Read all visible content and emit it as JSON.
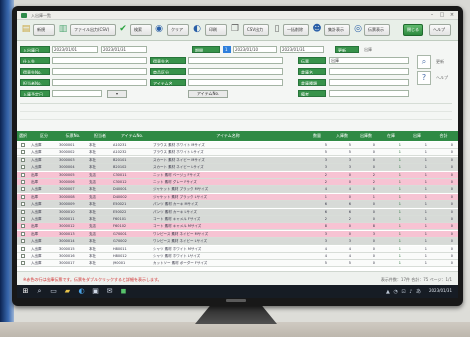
{
  "app": {
    "title": "入出庫一覧",
    "accent": "#2f8a44",
    "row_highlight": "#f7c3d3"
  },
  "toolbar": {
    "buttons": [
      {
        "label": "新規",
        "icon": "folder-icon"
      },
      {
        "label": "ファイル出力(CSV)",
        "icon": "file-icon"
      },
      {
        "label": "検索",
        "icon": "check-icon"
      },
      {
        "label": "クリア",
        "icon": "globe-icon"
      },
      {
        "label": "印刷",
        "icon": "refresh-icon"
      },
      {
        "label": "CSV出力",
        "icon": "copy-icon"
      },
      {
        "label": "一括削除",
        "icon": "document-icon"
      },
      {
        "label": "集計表示",
        "icon": "user-icon"
      },
      {
        "label": "伝票表示",
        "icon": "eye-icon"
      }
    ],
    "right_buttons": [
      "閉じる",
      "ヘルプ"
    ]
  },
  "search": {
    "labels": [
      "入出庫日",
      "仕入先",
      "得意先No.",
      "担当者No.",
      "入庫予定日"
    ],
    "mid_labels": [
      "得意先名",
      "商品区分",
      "アイテム名"
    ],
    "period_label": "期間",
    "status_label": "更新",
    "right_labels": [
      "伝票",
      "倉庫名",
      "倉庫種類",
      "備考"
    ],
    "date_from": "2023/01/01",
    "date_to": "2023/01/31",
    "sub_date": "2023/01/10",
    "blue_value": "1",
    "extra_label": "アイテムNo.",
    "right_value": "出庫",
    "side_texts": [
      "更新",
      "ヘルプ"
    ]
  },
  "grid": {
    "columns": [
      "選択",
      "区分",
      "伝票No.",
      "担当者",
      "アイテムNo.",
      "アイテム名称",
      "数量",
      "入庫数",
      "出庫数",
      "在庫",
      "出庫",
      "合計"
    ],
    "rows": [
      {
        "kind": "入出庫",
        "slip": "3000001",
        "staff": "本社",
        "item": "A10231",
        "name": "ブラウス 素材 ホワイト Mサイズ",
        "qty": "5",
        "in": "5",
        "out": "0",
        "stock": "1",
        "a": "1",
        "b": "0",
        "color": "white"
      },
      {
        "kind": "入出庫",
        "slip": "3000002",
        "staff": "本社",
        "item": "A10232",
        "name": "ブラウス 素材 ホワイト Lサイズ",
        "qty": "5",
        "in": "5",
        "out": "0",
        "stock": "1",
        "a": "1",
        "b": "0",
        "color": "white"
      },
      {
        "kind": "入出庫",
        "slip": "3000003",
        "staff": "本社",
        "item": "B20101",
        "name": "スカート 素材 ネイビー Mサイズ",
        "qty": "3",
        "in": "3",
        "out": "0",
        "stock": "1",
        "a": "1",
        "b": "0",
        "color": "grey"
      },
      {
        "kind": "入出庫",
        "slip": "3000004",
        "staff": "本社",
        "item": "B20102",
        "name": "スカート 素材 ネイビー Lサイズ",
        "qty": "3",
        "in": "3",
        "out": "0",
        "stock": "1",
        "a": "1",
        "b": "0",
        "color": "grey"
      },
      {
        "kind": "出庫",
        "slip": "3000005",
        "staff": "支店",
        "item": "C30011",
        "name": "ニット 素材 ベージュ Fサイズ",
        "qty": "2",
        "in": "0",
        "out": "2",
        "stock": "1",
        "a": "1",
        "b": "0",
        "color": "pink"
      },
      {
        "kind": "出庫",
        "slip": "3000006",
        "staff": "支店",
        "item": "C30012",
        "name": "ニット 素材 グレー Fサイズ",
        "qty": "2",
        "in": "0",
        "out": "2",
        "stock": "1",
        "a": "1",
        "b": "0",
        "color": "pink"
      },
      {
        "kind": "入出庫",
        "slip": "3000007",
        "staff": "本社",
        "item": "D40001",
        "name": "ジャケット 素材 ブラック Mサイズ",
        "qty": "4",
        "in": "4",
        "out": "0",
        "stock": "1",
        "a": "1",
        "b": "0",
        "color": "grey"
      },
      {
        "kind": "出庫",
        "slip": "3000008",
        "staff": "支店",
        "item": "D40002",
        "name": "ジャケット 素材 ブラック Lサイズ",
        "qty": "1",
        "in": "0",
        "out": "1",
        "stock": "1",
        "a": "1",
        "b": "0",
        "color": "pink"
      },
      {
        "kind": "入出庫",
        "slip": "3000009",
        "staff": "本社",
        "item": "E50021",
        "name": "パンツ 素材 カーキ Mサイズ",
        "qty": "6",
        "in": "6",
        "out": "0",
        "stock": "1",
        "a": "1",
        "b": "0",
        "color": "grey"
      },
      {
        "kind": "入出庫",
        "slip": "3000010",
        "staff": "本社",
        "item": "E50022",
        "name": "パンツ 素材 カーキ Lサイズ",
        "qty": "6",
        "in": "6",
        "out": "0",
        "stock": "1",
        "a": "1",
        "b": "0",
        "color": "grey"
      },
      {
        "kind": "入出庫",
        "slip": "3000011",
        "staff": "本社",
        "item": "F60101",
        "name": "コート 素材 キャメル Fサイズ",
        "qty": "2",
        "in": "2",
        "out": "0",
        "stock": "1",
        "a": "1",
        "b": "0",
        "color": "grey"
      },
      {
        "kind": "出庫",
        "slip": "3000012",
        "staff": "支店",
        "item": "F60102",
        "name": "コート 素材 キャメル Mサイズ",
        "qty": "8",
        "in": "0",
        "out": "8",
        "stock": "1",
        "a": "1",
        "b": "0",
        "color": "pink"
      },
      {
        "kind": "出庫",
        "slip": "3000013",
        "staff": "支店",
        "item": "G70001",
        "name": "ワンピース 素材 ネイビー Mサイズ",
        "qty": "3",
        "in": "0",
        "out": "3",
        "stock": "1",
        "a": "1",
        "b": "0",
        "color": "pink"
      },
      {
        "kind": "入出庫",
        "slip": "3000014",
        "staff": "本社",
        "item": "G70002",
        "name": "ワンピース 素材 ネイビー Lサイズ",
        "qty": "3",
        "in": "3",
        "out": "0",
        "stock": "1",
        "a": "1",
        "b": "0",
        "color": "grey"
      },
      {
        "kind": "入出庫",
        "slip": "3000015",
        "staff": "本社",
        "item": "H80011",
        "name": "シャツ 素材 ホワイト Mサイズ",
        "qty": "4",
        "in": "4",
        "out": "0",
        "stock": "1",
        "a": "1",
        "b": "0",
        "color": "white"
      },
      {
        "kind": "入出庫",
        "slip": "3000016",
        "staff": "本社",
        "item": "H80012",
        "name": "シャツ 素材 ホワイト Lサイズ",
        "qty": "4",
        "in": "4",
        "out": "0",
        "stock": "1",
        "a": "1",
        "b": "0",
        "color": "white"
      },
      {
        "kind": "入出庫",
        "slip": "3000017",
        "staff": "本社",
        "item": "J90001",
        "name": "カットソー 素材 ボーダー Fサイズ",
        "qty": "5",
        "in": "5",
        "out": "0",
        "stock": "1",
        "a": "1",
        "b": "0",
        "color": "white"
      }
    ]
  },
  "status": {
    "message": "※赤色の行は出庫伝票です。伝票をダブルクリックすると詳細を表示します。",
    "right": "表示件数：17件 合計：75 ページ：1/1"
  },
  "taskbar": {
    "icons": [
      "windows-icon",
      "search-icon",
      "task-view-icon",
      "explorer-icon",
      "edge-icon",
      "store-icon",
      "mail-icon",
      "app-icon"
    ],
    "tray": "2023/01/31"
  }
}
